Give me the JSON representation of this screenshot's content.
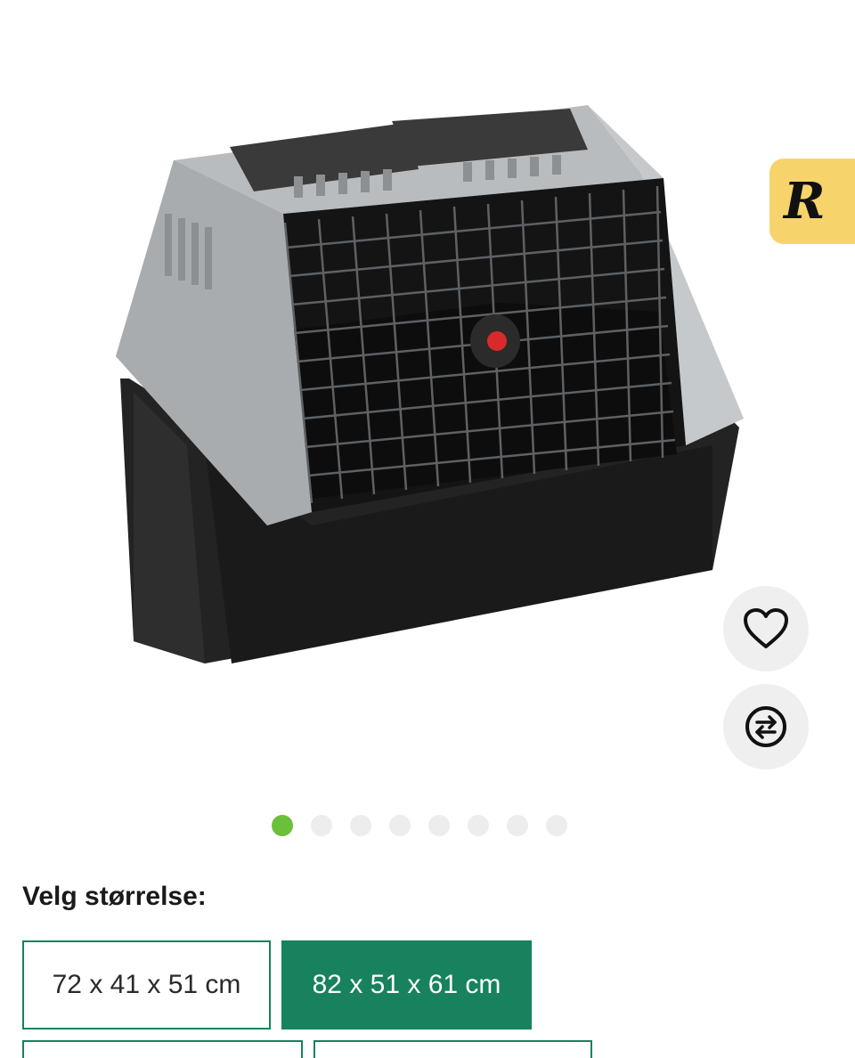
{
  "product": {
    "image_alt": "Dog car crate - grey and black with wire door"
  },
  "badge": {
    "letter": "R"
  },
  "actions": {
    "favorite_icon": "heart-icon",
    "compare_icon": "compare-arrows-icon"
  },
  "gallery": {
    "total": 8,
    "active_index": 0
  },
  "size_selector": {
    "label": "Velg størrelse:",
    "options": [
      {
        "label": "72 x 41 x 51 cm",
        "selected": false
      },
      {
        "label": "82 x 51 x 61 cm",
        "selected": true
      },
      {
        "label": "",
        "selected": false
      },
      {
        "label": "",
        "selected": false
      }
    ]
  },
  "colors": {
    "accent": "#17825d",
    "dot_active": "#6bbf3a",
    "badge_bg": "#f7d36c"
  }
}
